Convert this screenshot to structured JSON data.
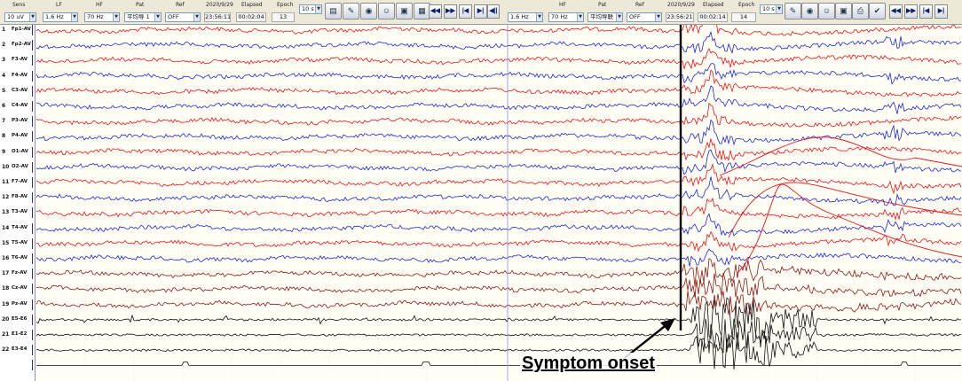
{
  "toolbar": {
    "left": {
      "sens_label": "Sens",
      "sens_value": "10 uV",
      "lf_label": "LF",
      "lf_value": "1.6 Hz",
      "hf_label": "HF",
      "hf_value": "70 Hz",
      "pat_label": "Pat",
      "pat_value": "平均导 1",
      "ref_label": "Ref",
      "ref_value": "OFF",
      "date": "2020/9/29",
      "time": "23:56:11",
      "elapsed_label": "Elapsed",
      "elapsed_value": "00:02:04",
      "epoch_label": "Epoch",
      "epoch_value": "13",
      "timebase_value": "10 s"
    },
    "right": {
      "lf_value": "1.6 Hz",
      "hf_label": "HF",
      "hf_value": "70 Hz",
      "pat_label": "Pat",
      "pat_value": "平均导联",
      "ref_label": "Ref",
      "ref_value": "OFF",
      "date": "2020/9/29",
      "time": "23:56:21",
      "elapsed_label": "Elapsed",
      "elapsed_value": "00:02:14",
      "epoch_label": "Epoch",
      "epoch_value": "14",
      "timebase_value": "10 s"
    },
    "icons": [
      "montage-icon",
      "pen-icon",
      "globe-icon",
      "person-icon",
      "photo-icon",
      "chart-icon",
      "printer-icon",
      "check-icon"
    ],
    "nav_icons": [
      "fast-back-icon",
      "fast-forward-icon",
      "first-page-icon",
      "last-page-icon",
      "play-back-icon"
    ]
  },
  "channels": [
    {
      "num": "1",
      "name": "Fp1-AV",
      "color": "#e8141c"
    },
    {
      "num": "2",
      "name": "Fp2-AV",
      "color": "#1a2ad6"
    },
    {
      "num": "3",
      "name": "F3-AV",
      "color": "#e8141c"
    },
    {
      "num": "4",
      "name": "F4-AV",
      "color": "#1a2ad6"
    },
    {
      "num": "5",
      "name": "C3-AV",
      "color": "#e8141c"
    },
    {
      "num": "6",
      "name": "C4-AV",
      "color": "#1a2ad6"
    },
    {
      "num": "7",
      "name": "P3-AV",
      "color": "#e8141c"
    },
    {
      "num": "8",
      "name": "P4-AV",
      "color": "#1a2ad6"
    },
    {
      "num": "9",
      "name": "O1-AV",
      "color": "#e8141c"
    },
    {
      "num": "10",
      "name": "O2-AV",
      "color": "#1a2ad6"
    },
    {
      "num": "11",
      "name": "F7-AV",
      "color": "#e8141c"
    },
    {
      "num": "12",
      "name": "F8-AV",
      "color": "#1a2ad6"
    },
    {
      "num": "13",
      "name": "T3-AV",
      "color": "#e8141c"
    },
    {
      "num": "14",
      "name": "T4-AV",
      "color": "#1a2ad6"
    },
    {
      "num": "15",
      "name": "T5-AV",
      "color": "#e8141c"
    },
    {
      "num": "16",
      "name": "T6-AV",
      "color": "#1a2ad6"
    },
    {
      "num": "17",
      "name": "Fz-AV",
      "color": "#8b1a1a"
    },
    {
      "num": "18",
      "name": "Cz-AV",
      "color": "#8b1a1a"
    },
    {
      "num": "19",
      "name": "Pz-AV",
      "color": "#8b1a1a"
    },
    {
      "num": "20",
      "name": "E5-E6",
      "color": "#111111"
    },
    {
      "num": "21",
      "name": "E1-E2",
      "color": "#111111"
    },
    {
      "num": "22",
      "name": "E3-E4",
      "color": "#111111"
    },
    {
      "num": "",
      "name": "",
      "color": "#111111"
    }
  ],
  "annotation": {
    "text": "Symptom onset"
  }
}
